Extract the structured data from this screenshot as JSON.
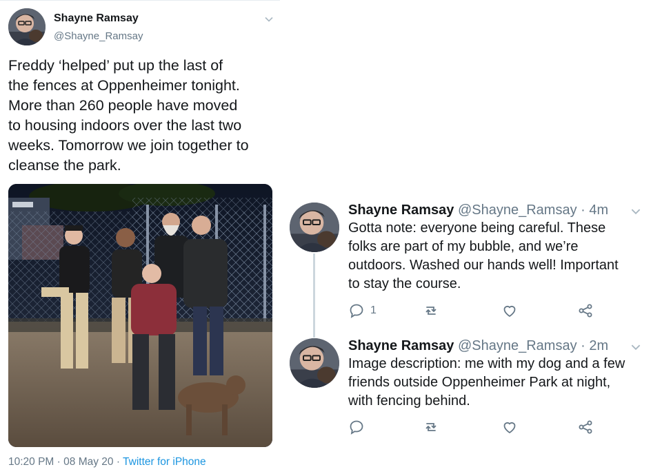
{
  "main_tweet": {
    "author": {
      "name": "Shayne Ramsay",
      "handle": "@Shayne_Ramsay"
    },
    "text_lines": [
      "Freddy ‘helped’ put up the last of",
      "the fences at Oppenheimer tonight.",
      "More than 260 people have moved",
      "to housing indoors over the last two",
      "weeks. Tomorrow we join together to",
      "cleanse the park."
    ],
    "meta": {
      "time": "10:20 PM",
      "sep": " · ",
      "date": "08 May 20",
      "source": "Twitter for iPhone"
    },
    "icons": {
      "menu": "chevron-down-icon"
    }
  },
  "replies": [
    {
      "name": "Shayne Ramsay",
      "handle": "@Shayne_Ramsay",
      "time": " · 4m",
      "text_lines": [
        "Gotta note: everyone being careful. These",
        "folks are part of my bubble, and we’re",
        "outdoors. Washed our hands well! Important",
        "to stay the course."
      ],
      "reply_count": "1"
    },
    {
      "name": "Shayne Ramsay",
      "handle": "@Shayne_Ramsay",
      "time": " · 2m",
      "text_lines": [
        "Image description: me with my dog and a few",
        "friends outside Oppenheimer Park at night,",
        "with fencing behind."
      ],
      "reply_count": ""
    }
  ],
  "colors": {
    "text": "#14171a",
    "secondary": "#657786",
    "link": "#1b95e0",
    "thread_line": "#ccd6dd"
  }
}
